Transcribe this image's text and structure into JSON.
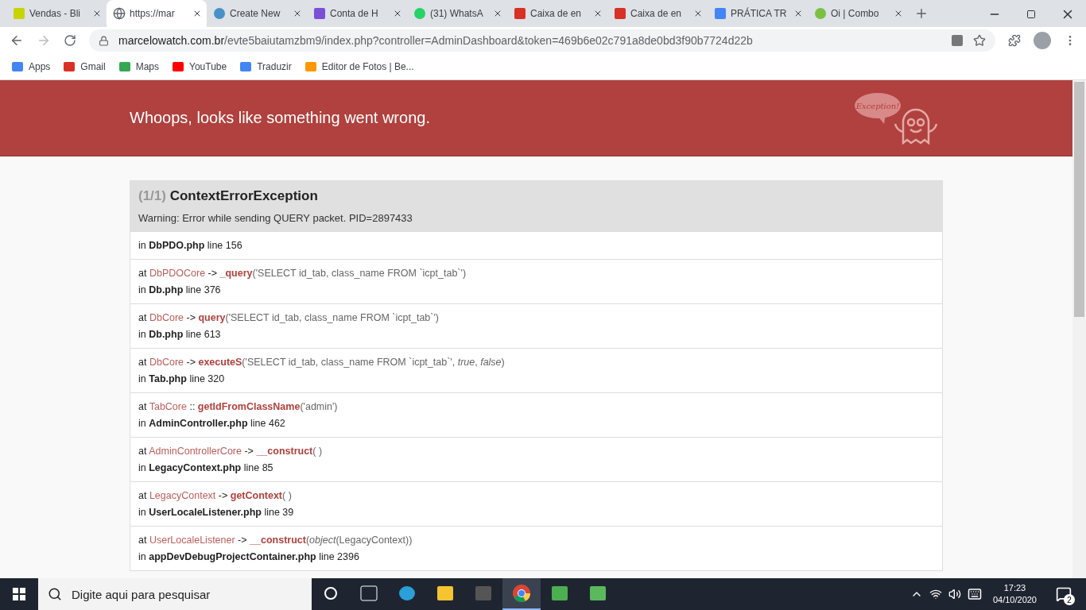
{
  "browser": {
    "tabs": [
      {
        "title": "Vendas - Bli",
        "selected": false
      },
      {
        "title": "https://mar",
        "selected": true
      },
      {
        "title": "Create New",
        "selected": false
      },
      {
        "title": "Conta de H",
        "selected": false
      },
      {
        "title": "(31) WhatsA",
        "selected": false
      },
      {
        "title": "Caixa de en",
        "selected": false
      },
      {
        "title": "Caixa de en",
        "selected": false
      },
      {
        "title": "PRÁTICA TR",
        "selected": false
      },
      {
        "title": "Oi | Combo",
        "selected": false
      }
    ],
    "address": {
      "host": "marcelowatch.com.br",
      "path": "/evte5baiutamzbm9/index.php?controller=AdminDashboard&token=469b6e02c791a8de0bd3f90b7724d22b"
    },
    "bookmarks": [
      "Apps",
      "Gmail",
      "Maps",
      "YouTube",
      "Traduzir",
      "Editor de Fotos | Be..."
    ]
  },
  "page": {
    "header": {
      "title": "Whoops, looks like something went wrong.",
      "mascot_text": "Exception!"
    },
    "exception": {
      "counter": "(1/1)",
      "name": "ContextErrorException",
      "message": "Warning: Error while sending QUERY packet. PID=2897433"
    },
    "trace": [
      {
        "in_word": "in",
        "file": "DbPDO.php",
        "line": "line 156"
      },
      {
        "at_word": "at",
        "class": "DbPDOCore",
        "call_type": "->",
        "function": "_query",
        "args": "('SELECT id_tab, class_name FROM `icpt_tab`')",
        "in_word": "in",
        "file": "Db.php",
        "line": "line 376"
      },
      {
        "at_word": "at",
        "class": "DbCore",
        "call_type": "->",
        "function": "query",
        "args": "('SELECT id_tab, class_name FROM `icpt_tab`')",
        "in_word": "in",
        "file": "Db.php",
        "line": "line 613"
      },
      {
        "at_word": "at",
        "class": "DbCore",
        "call_type": "->",
        "function": "executeS",
        "args": "('SELECT id_tab, class_name FROM `icpt_tab`', *true*, *false*)",
        "in_word": "in",
        "file": "Tab.php",
        "line": "line 320"
      },
      {
        "at_word": "at",
        "class": "TabCore",
        "call_type": "::",
        "function": "getIdFromClassName",
        "args": "('admin')",
        "in_word": "in",
        "file": "AdminController.php",
        "line": "line 462"
      },
      {
        "at_word": "at",
        "class": "AdminControllerCore",
        "call_type": "->",
        "function": "__construct",
        "args": "( )",
        "in_word": "in",
        "file": "LegacyContext.php",
        "line": "line 85"
      },
      {
        "at_word": "at",
        "class": "LegacyContext",
        "call_type": "->",
        "function": "getContext",
        "args": "( )",
        "in_word": "in",
        "file": "UserLocaleListener.php",
        "line": "line 39"
      },
      {
        "at_word": "at",
        "class": "UserLocaleListener",
        "call_type": "->",
        "function": "__construct",
        "args": "(*object*(LegacyContext))",
        "in_word": "in",
        "file": "appDevDebugProjectContainer.php",
        "line": "line 2396"
      }
    ]
  },
  "taskbar": {
    "search_placeholder": "Digite aqui para pesquisar",
    "apps": [
      {
        "selected": false
      },
      {
        "selected": false
      },
      {
        "selected": false
      },
      {
        "selected": false
      },
      {
        "selected": false
      },
      {
        "selected": true
      },
      {
        "selected": false
      },
      {
        "selected": false
      }
    ],
    "time": "17:23",
    "date": "04/10/2020",
    "notifications": "2"
  }
}
